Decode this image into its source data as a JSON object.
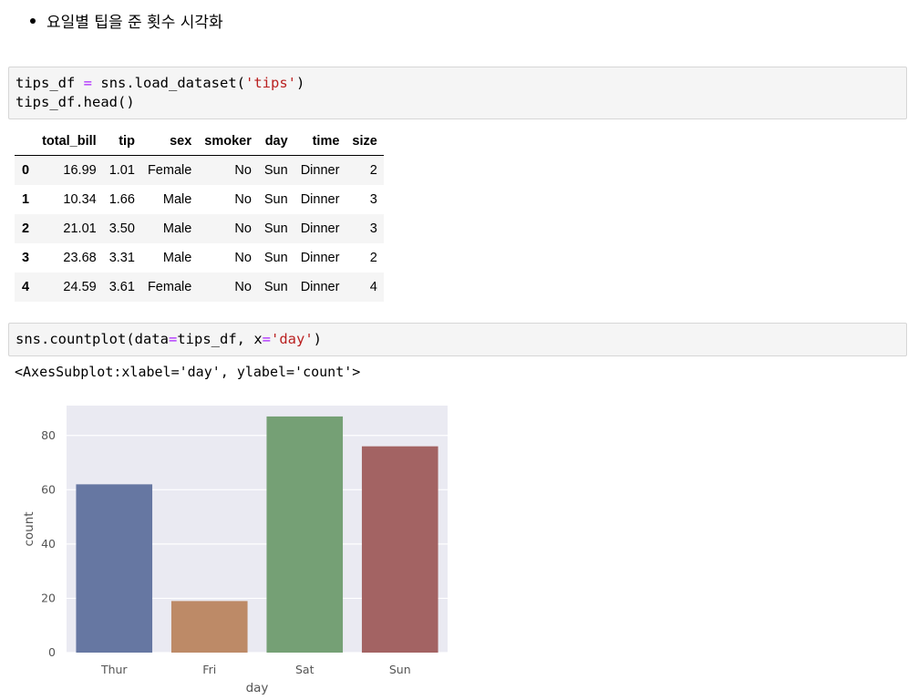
{
  "markdown": {
    "bullet_text": "요일별 팁을 준 횟수 시각화"
  },
  "cell1": {
    "line1": {
      "var": "tips_df",
      "eq": "=",
      "call": "sns.load_dataset(",
      "arg": "'tips'",
      "close": ")"
    },
    "line2": "tips_df.head()"
  },
  "table": {
    "columns": [
      "",
      "total_bill",
      "tip",
      "sex",
      "smoker",
      "day",
      "time",
      "size"
    ],
    "rows": [
      [
        "0",
        "16.99",
        "1.01",
        "Female",
        "No",
        "Sun",
        "Dinner",
        "2"
      ],
      [
        "1",
        "10.34",
        "1.66",
        "Male",
        "No",
        "Sun",
        "Dinner",
        "3"
      ],
      [
        "2",
        "21.01",
        "3.50",
        "Male",
        "No",
        "Sun",
        "Dinner",
        "3"
      ],
      [
        "3",
        "23.68",
        "3.31",
        "Male",
        "No",
        "Sun",
        "Dinner",
        "2"
      ],
      [
        "4",
        "24.59",
        "3.61",
        "Female",
        "No",
        "Sun",
        "Dinner",
        "4"
      ]
    ]
  },
  "cell2": {
    "prefix": "sns.countplot(data",
    "eq1": "=",
    "mid": "tips_df, x",
    "eq2": "=",
    "arg": "'day'",
    "close": ")"
  },
  "output_text": "<AxesSubplot:xlabel='day', ylabel='count'>",
  "chart_data": {
    "type": "bar",
    "categories": [
      "Thur",
      "Fri",
      "Sat",
      "Sun"
    ],
    "values": [
      62,
      19,
      87,
      76
    ],
    "colors": [
      "#6677a2",
      "#bd8a67",
      "#75a075",
      "#a36363"
    ],
    "xlabel": "day",
    "ylabel": "count",
    "ylim": [
      0,
      91
    ],
    "yticks": [
      0,
      20,
      40,
      60,
      80
    ],
    "grid": true,
    "background": "#eaeaf2"
  }
}
